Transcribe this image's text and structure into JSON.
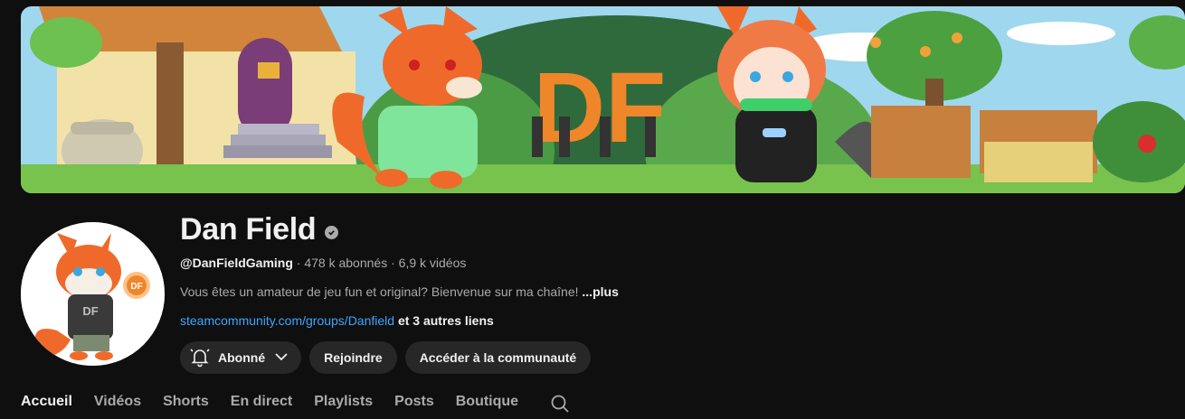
{
  "banner": {
    "logo_text": "DF"
  },
  "avatar": {
    "badge_text": "DF",
    "shirt_text": "DF"
  },
  "channel": {
    "name": "Dan Field",
    "handle": "@DanFieldGaming",
    "separator": "·",
    "subscribers": "478 k abonnés",
    "videos": "6,9 k vidéos",
    "description": "Vous êtes un amateur de jeu fun et original? Bienvenue sur ma chaîne!",
    "more_label": "...plus",
    "link": "steamcommunity.com/groups/Danfield",
    "more_links": "et 3 autres liens"
  },
  "actions": {
    "subscribed_label": "Abonné",
    "join_label": "Rejoindre",
    "community_label": "Accéder à la communauté"
  },
  "tabs": [
    {
      "label": "Accueil"
    },
    {
      "label": "Vidéos"
    },
    {
      "label": "Shorts"
    },
    {
      "label": "En direct"
    },
    {
      "label": "Playlists"
    },
    {
      "label": "Posts"
    },
    {
      "label": "Boutique"
    }
  ],
  "colors": {
    "background": "#0f0f0f",
    "text_primary": "#f1f1f1",
    "text_secondary": "#aaaaaa",
    "link": "#3ea6ff",
    "button_bg": "#272727",
    "brand_orange": "#f0862a"
  }
}
